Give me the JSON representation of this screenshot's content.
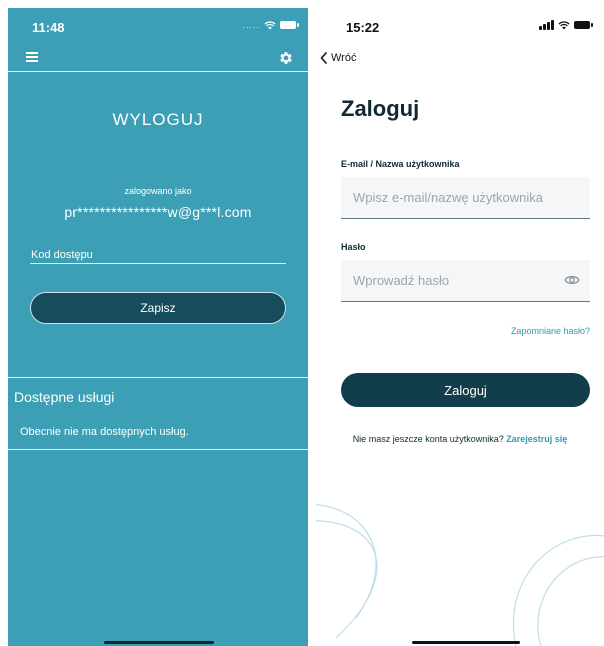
{
  "left": {
    "status": {
      "time": "11:48",
      "signal_dots": "....."
    },
    "title": "WYLOGUJ",
    "logged_in_as": "zalogowano jako",
    "email": "pr****************w@g***l.com",
    "code_label": "Kod dostępu",
    "save_button": "Zapisz",
    "services_title": "Dostępne usługi",
    "services_empty": "Obecnie nie ma dostępnych usług.",
    "colors": {
      "background": "#3d9fb5",
      "button": "#174c5c"
    }
  },
  "right": {
    "status": {
      "time": "15:22"
    },
    "back_label": "Wróć",
    "title": "Zaloguj",
    "email_label": "E-mail / Nazwa użytkownika",
    "email_placeholder": "Wpisz e-mail/nazwę użytkownika",
    "password_label": "Hasło",
    "password_placeholder": "Wprowadź hasło",
    "forgot_password": "Zapomniane hasło?",
    "login_button": "Zaloguj",
    "no_account": "Nie masz jeszcze konta użytkownika?",
    "register_link": "Zarejestruj się",
    "colors": {
      "accent": "#2f9bb2",
      "button": "#123d4a",
      "title": "#0f2a33"
    }
  }
}
